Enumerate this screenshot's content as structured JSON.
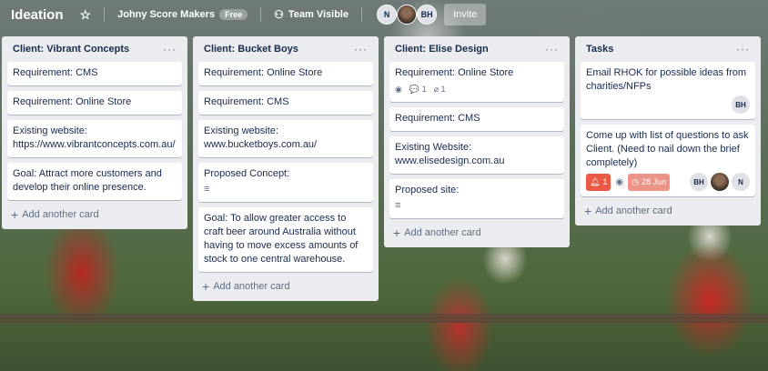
{
  "header": {
    "board_title": "Ideation",
    "team_name": "Johny Score Makers",
    "plan_badge": "Free",
    "visibility": "Team Visible",
    "members": [
      "N",
      "",
      "BH"
    ],
    "invite_label": "Invite"
  },
  "lists": [
    {
      "title": "Client: Vibrant Concepts",
      "cards": [
        {
          "text": "Requirement: CMS"
        },
        {
          "text": "Requirement: Online Store"
        },
        {
          "text": "Existing website: https://www.vibrantconcepts.com.au/"
        },
        {
          "text": "Goal: Attract more customers and develop their online presence."
        }
      ],
      "add_label": "Add another card"
    },
    {
      "title": "Client: Bucket Boys",
      "cards": [
        {
          "text": "Requirement: Online Store"
        },
        {
          "text": "Requirement: CMS"
        },
        {
          "text": "Existing website: www.bucketboys.com.au/"
        },
        {
          "text": "Proposed Concept:"
        },
        {
          "text": "Goal: To allow greater access to craft beer around Australia without having to move excess amounts of stock to one central warehouse."
        }
      ],
      "add_label": "Add another card"
    },
    {
      "title": "Client: Elise Design",
      "cards": [
        {
          "text": "Requirement: Online Store",
          "comments": "1",
          "attachments": "1"
        },
        {
          "text": "Requirement: CMS"
        },
        {
          "text": "Existing Website: www.elisedesign.com.au"
        },
        {
          "text": "Proposed site:"
        }
      ],
      "add_label": "Add another card"
    },
    {
      "title": "Tasks",
      "cards": [
        {
          "text": "Email RHOK for possible ideas from charities/NFPs",
          "members": [
            "BH"
          ]
        },
        {
          "text": "Come up with list of questions to ask Client. (Need to nail down the brief completely)",
          "alerts": "1",
          "due": "28 Jun",
          "members": [
            "BH",
            "",
            "N"
          ]
        }
      ],
      "add_label": "Add another card"
    }
  ]
}
